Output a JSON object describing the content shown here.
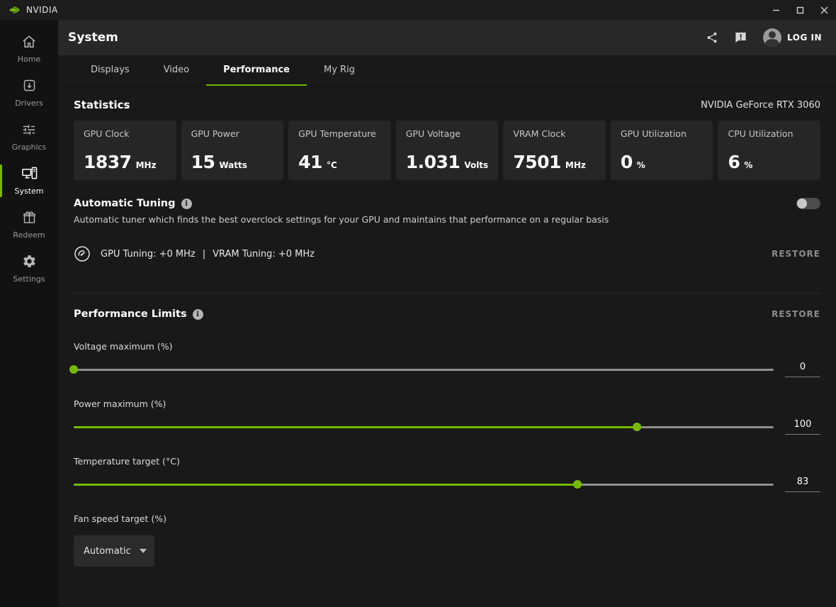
{
  "colors": {
    "accent": "#76b900",
    "header_bg": "#282828",
    "card_bg": "#262626",
    "content_bg": "#191919"
  },
  "titlebar": {
    "app_name": "NVIDIA"
  },
  "sidebar": {
    "items": [
      {
        "label": "Home",
        "icon": "home-icon",
        "active": false
      },
      {
        "label": "Drivers",
        "icon": "download-box-icon",
        "active": false
      },
      {
        "label": "Graphics",
        "icon": "tune-sliders-icon",
        "active": false
      },
      {
        "label": "System",
        "icon": "computer-icon",
        "active": true
      },
      {
        "label": "Redeem",
        "icon": "gift-icon",
        "active": false
      },
      {
        "label": "Settings",
        "icon": "gear-icon",
        "active": false
      }
    ]
  },
  "header": {
    "title": "System",
    "login_label": "LOG IN"
  },
  "tabs": [
    {
      "label": "Displays",
      "active": false
    },
    {
      "label": "Video",
      "active": false
    },
    {
      "label": "Performance",
      "active": true
    },
    {
      "label": "My Rig",
      "active": false
    }
  ],
  "statistics": {
    "heading": "Statistics",
    "gpu_name": "NVIDIA GeForce RTX 3060",
    "cards": [
      {
        "label": "GPU Clock",
        "value": "1837",
        "unit": "MHz"
      },
      {
        "label": "GPU Power",
        "value": "15",
        "unit": "Watts"
      },
      {
        "label": "GPU Temperature",
        "value": "41",
        "unit": "°C"
      },
      {
        "label": "GPU Voltage",
        "value": "1.031",
        "unit": "Volts"
      },
      {
        "label": "VRAM Clock",
        "value": "7501",
        "unit": "MHz"
      },
      {
        "label": "GPU Utilization",
        "value": "0",
        "unit": "%"
      },
      {
        "label": "CPU Utilization",
        "value": "6",
        "unit": "%"
      }
    ]
  },
  "automatic_tuning": {
    "heading": "Automatic Tuning",
    "description": "Automatic tuner which finds the best overclock settings for your GPU and maintains that performance on a regular basis",
    "toggle_on": false,
    "gpu_tuning": "GPU Tuning: +0 MHz",
    "separator": "|",
    "vram_tuning": "VRAM Tuning: +0 MHz",
    "restore_label": "RESTORE"
  },
  "performance_limits": {
    "heading": "Performance Limits",
    "restore_label": "RESTORE",
    "sliders": [
      {
        "label": "Voltage maximum (%)",
        "value": "0",
        "percent": 0
      },
      {
        "label": "Power maximum (%)",
        "value": "100",
        "percent": 80.5
      },
      {
        "label": "Temperature target (°C)",
        "value": "83",
        "percent": 72
      }
    ],
    "fan": {
      "label": "Fan speed target (%)",
      "selected": "Automatic"
    }
  }
}
